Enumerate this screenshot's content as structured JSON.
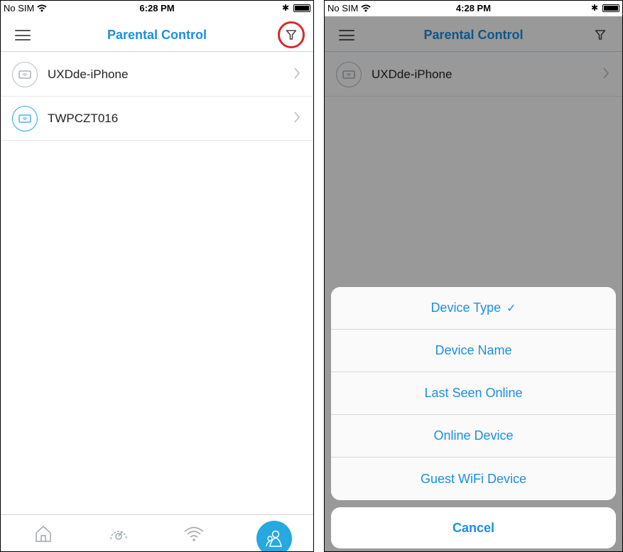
{
  "left": {
    "status": {
      "carrier": "No SIM",
      "time": "6:28 PM"
    },
    "nav": {
      "title": "Parental Control"
    },
    "devices": [
      {
        "name": "UXDde-iPhone",
        "icon": "device-offline-icon"
      },
      {
        "name": "TWPCZT016",
        "icon": "device-online-icon"
      }
    ],
    "tabs": [
      "home-icon",
      "speed-icon",
      "wifi-icon",
      "parental-control-icon"
    ]
  },
  "right": {
    "status": {
      "carrier": "No SIM",
      "time": "4:28 PM"
    },
    "nav": {
      "title": "Parental Control"
    },
    "devices": [
      {
        "name": "UXDde-iPhone",
        "icon": "device-offline-icon"
      }
    ],
    "sort_options": [
      {
        "label": "Device Type",
        "selected": true,
        "check": "✓"
      },
      {
        "label": "Device Name",
        "selected": false
      },
      {
        "label": "Last Seen Online",
        "selected": false
      },
      {
        "label": "Online Device",
        "selected": false
      },
      {
        "label": "Guest WiFi Device",
        "selected": false
      }
    ],
    "cancel_label": "Cancel"
  },
  "colors": {
    "accent": "#1a8fe3",
    "online": "#26a8e0",
    "highlight": "#d62b2b"
  }
}
